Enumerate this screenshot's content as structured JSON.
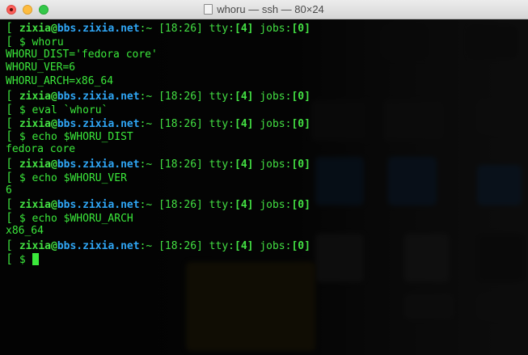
{
  "window": {
    "title": "whoru — ssh — 80×24"
  },
  "colors": {
    "prompt_green": "#43e043",
    "host_blue": "#2fa6f5",
    "output_green": "#3be83b",
    "titlebar": "#e2e2e2"
  },
  "prompt": {
    "user": "zixia",
    "at": "@",
    "host": "bbs.zixia.net",
    "tilde": ":~",
    "time": "[18:26]",
    "tty_label": " tty:",
    "tty_value": "[4]",
    "jobs_label": " jobs:",
    "jobs_value": "[0]",
    "bracket_top": "[",
    "bracket_bottom": "["
  },
  "lines": [
    {
      "command": "$ whoru",
      "output": [
        "WHORU_DIST='fedora core'",
        "WHORU_VER=6",
        "WHORU_ARCH=x86_64"
      ]
    },
    {
      "command": "$ eval `whoru`",
      "output": []
    },
    {
      "command": "$ echo $WHORU_DIST",
      "output": [
        "fedora core"
      ]
    },
    {
      "command": "$ echo $WHORU_VER",
      "output": [
        "6"
      ]
    },
    {
      "command": "$ echo $WHORU_ARCH",
      "output": [
        "x86_64"
      ]
    },
    {
      "command": "$ ",
      "output": []
    }
  ]
}
